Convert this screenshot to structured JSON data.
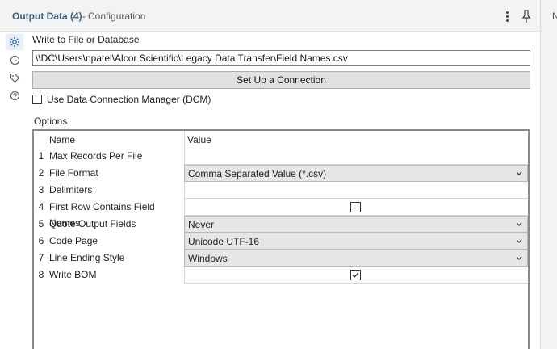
{
  "header": {
    "title": "Output Data (4)",
    "subtitle": "Configuration",
    "separator": "-",
    "right_letter": "N"
  },
  "rail": {
    "icons": [
      "gear-icon",
      "history-icon",
      "tag-icon",
      "help-icon"
    ]
  },
  "form": {
    "write_label": "Write to File or Database",
    "path_value": "\\\\DC\\Users\\npatel\\Alcor Scientific\\Legacy Data Transfer\\Field Names.csv",
    "connection_button": "Set Up a Connection",
    "dcm_label": "Use Data Connection Manager (DCM)",
    "dcm_checked": false,
    "options_label": "Options"
  },
  "options_table": {
    "headers": {
      "name": "Name",
      "value": "Value"
    },
    "rows": [
      {
        "num": "1",
        "name": "Max Records Per File",
        "value": "",
        "kind": "text"
      },
      {
        "num": "2",
        "name": "File Format",
        "value": "Comma Separated Value (*.csv)",
        "kind": "select"
      },
      {
        "num": "3",
        "name": "Delimiters",
        "value": "",
        "kind": "text"
      },
      {
        "num": "4",
        "name": "First Row Contains Field Names",
        "checked": false,
        "kind": "checkbox"
      },
      {
        "num": "5",
        "name": "Quote Output Fields",
        "value": "Never",
        "kind": "select"
      },
      {
        "num": "6",
        "name": "Code Page",
        "value": "Unicode UTF-16",
        "kind": "select"
      },
      {
        "num": "7",
        "name": "Line Ending Style",
        "value": "Windows",
        "kind": "select"
      },
      {
        "num": "8",
        "name": "Write BOM",
        "checked": true,
        "kind": "checkbox"
      }
    ]
  }
}
